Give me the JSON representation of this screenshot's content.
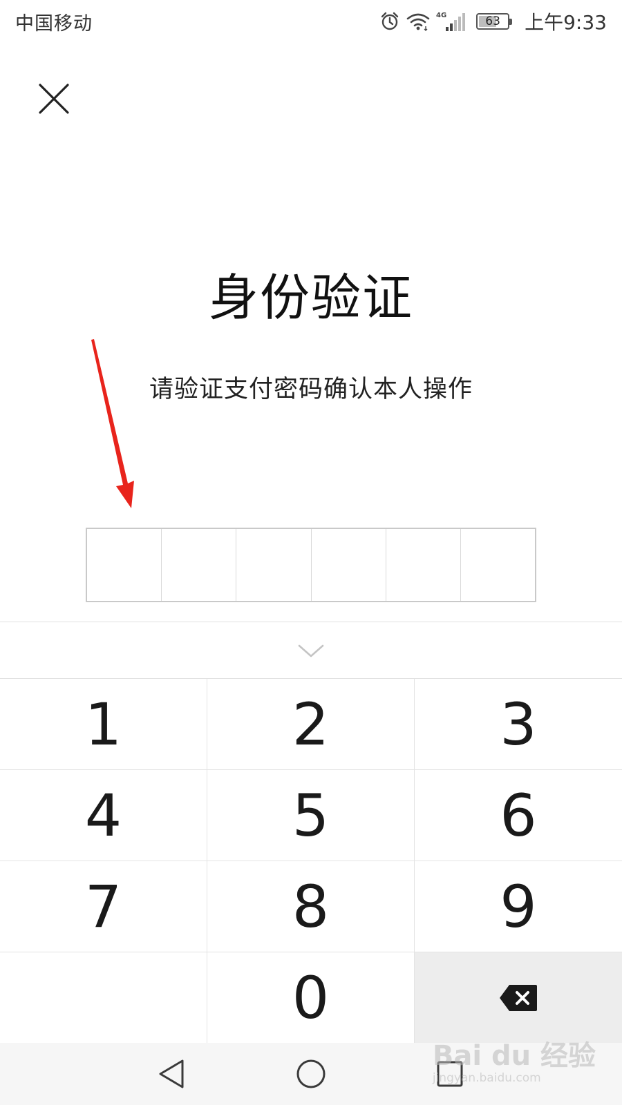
{
  "status_bar": {
    "carrier": "中国移动",
    "network_label": "4G",
    "battery_level": "63",
    "battery_fraction": 0.63,
    "time": "上午9:33",
    "icons": [
      "alarm-icon",
      "wifi-icon",
      "cellular-signal-icon",
      "battery-icon"
    ]
  },
  "header": {
    "close_icon": "close-icon"
  },
  "main": {
    "title": "身份验证",
    "subtitle": "请验证支付密码确认本人操作"
  },
  "pin_input": {
    "length": 6,
    "filled": 0
  },
  "annotation": {
    "arrow_color": "#e8241c"
  },
  "keyboard": {
    "toggle_icon": "chevron-down-icon",
    "keys": [
      "1",
      "2",
      "3",
      "4",
      "5",
      "6",
      "7",
      "8",
      "9",
      "",
      "0",
      "delete"
    ],
    "delete_icon": "backspace-icon"
  },
  "nav_bar": {
    "buttons": [
      "back-icon",
      "home-icon",
      "recents-icon"
    ]
  },
  "watermark": {
    "logo": "Bai du 经验",
    "url": "jingyan.baidu.com"
  },
  "colors": {
    "background": "#ffffff",
    "divider": "#e0e0e0",
    "delete_key_bg": "#ededed",
    "nav_bar_bg": "#f6f6f6"
  }
}
